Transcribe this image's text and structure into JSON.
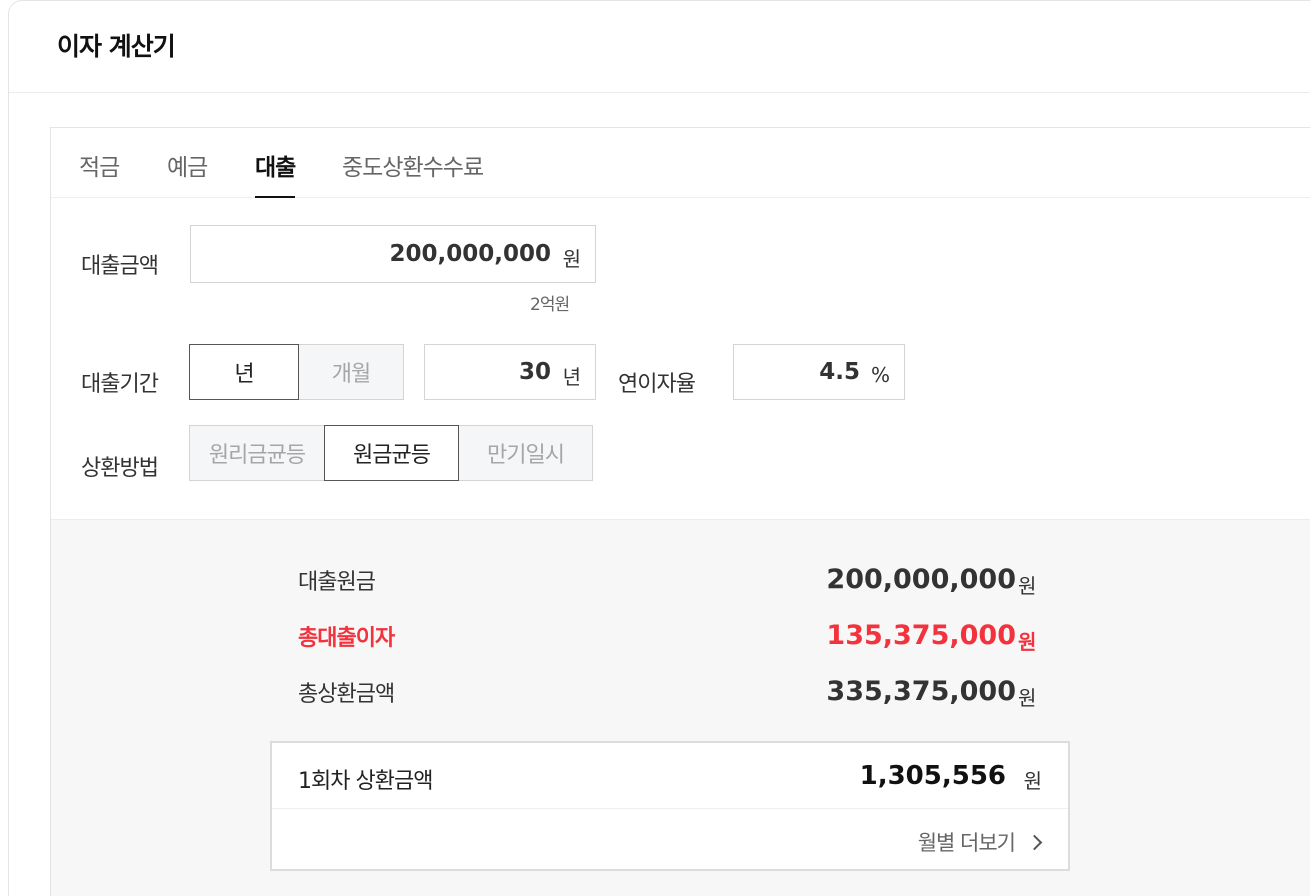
{
  "title": "이자 계산기",
  "tabs": [
    {
      "label": "적금",
      "active": false
    },
    {
      "label": "예금",
      "active": false
    },
    {
      "label": "대출",
      "active": true
    },
    {
      "label": "중도상환수수료",
      "active": false
    }
  ],
  "form": {
    "loan_amount": {
      "label": "대출금액",
      "value": "200,000,000",
      "unit": "원",
      "hint": "2억원"
    },
    "loan_period": {
      "label": "대출기간",
      "options": [
        "년",
        "개월"
      ],
      "selected": "년",
      "value": "30",
      "unit": "년"
    },
    "interest_rate": {
      "label": "연이자율",
      "value": "4.5",
      "unit": "%"
    },
    "repayment": {
      "label": "상환방법",
      "options": [
        "원리금균등",
        "원금균등",
        "만기일시"
      ],
      "selected": "원금균등"
    }
  },
  "results": {
    "principal": {
      "label": "대출원금",
      "value": "200,000,000",
      "unit": "원"
    },
    "total_interest": {
      "label": "총대출이자",
      "value": "135,375,000",
      "unit": "원"
    },
    "total_repayment": {
      "label": "총상환금액",
      "value": "335,375,000",
      "unit": "원"
    },
    "first_payment": {
      "label": "1회차 상환금액",
      "value": "1,305,556",
      "unit": "원"
    },
    "more_link": "월별 더보기"
  },
  "colors": {
    "accent_red": "#f2333e",
    "text": "#333333",
    "border": "#d4d4d4",
    "result_bg": "#f7f7f7"
  }
}
